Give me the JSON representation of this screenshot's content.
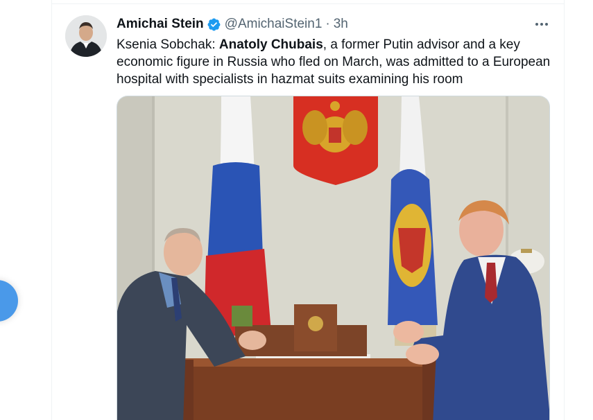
{
  "tweet": {
    "author": {
      "display_name": "Amichai Stein",
      "handle": "@AmichaiStein1",
      "verified": true
    },
    "separator": "·",
    "time": "3h",
    "text": {
      "prefix": "Ksenia Sobchak: ",
      "bold": "Anatoly Chubais",
      "suffix": ", a former Putin advisor and a key economic figure in Russia who fled on March, was admitted to a European hospital with specialists in hazmat suits examining his room"
    },
    "media": {
      "kind": "photo"
    }
  },
  "icons": {
    "verified": "verified-badge-icon",
    "more": "more-options-icon",
    "compose": "compose-tweet-icon"
  },
  "colors": {
    "accent": "#1d9bf0",
    "fab": "#4a99e9",
    "text_primary": "#0f1419",
    "text_secondary": "#536471",
    "border": "#eff3f4"
  }
}
